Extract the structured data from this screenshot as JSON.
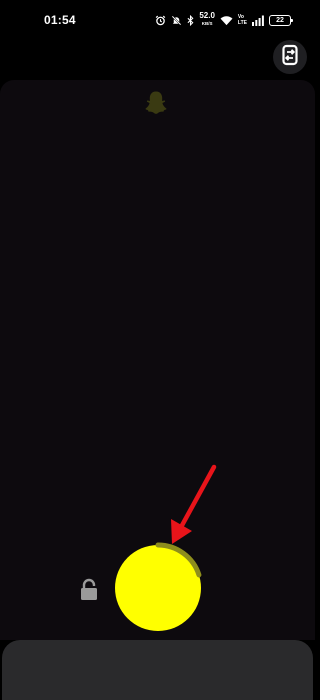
{
  "status_bar": {
    "time": "01:54",
    "net_speed_value": "52.0",
    "net_speed_unit": "KB/S",
    "volte_top": "Vo",
    "volte_bottom": "LTE",
    "battery": "22",
    "icons": [
      "alarm-icon",
      "mute-icon",
      "bluetooth-icon",
      "wifi-icon",
      "signal-icon",
      "battery-icon"
    ]
  },
  "camera": {
    "flip_icon": "flip-camera-icon",
    "ghost_icon": "snapchat-ghost-icon",
    "lock_icon": "lock-icon",
    "shutter": {
      "recording_progress": 0.2
    },
    "annotation": "red-arrow-icon"
  },
  "colors": {
    "background": "#000000",
    "camera_view": "#0d0a0e",
    "shutter": "#ffff00",
    "progress": "#8e8e1c",
    "ghost": "#3a3a12",
    "arrow": "#e8141a",
    "bottom_panel": "#2a2a2c"
  }
}
